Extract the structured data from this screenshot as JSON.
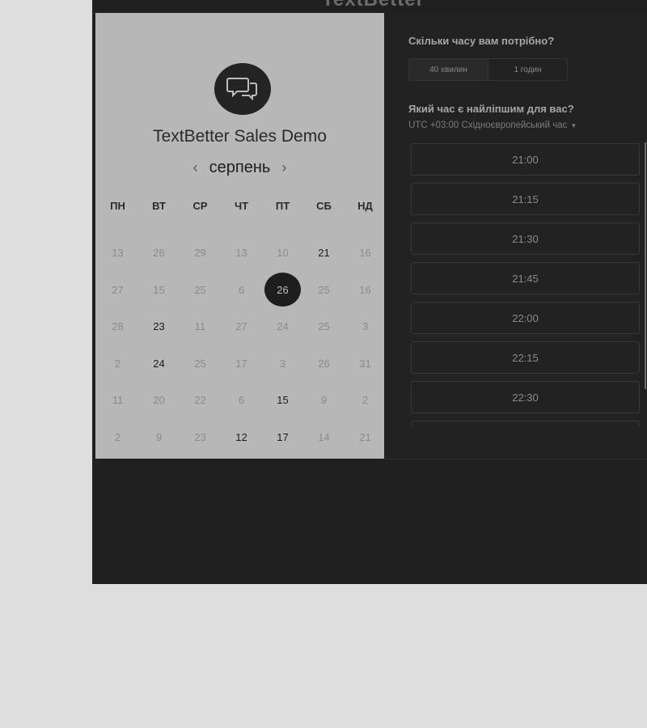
{
  "brand": "TextBetter",
  "event": {
    "title": "TextBetter Sales Demo"
  },
  "calendar": {
    "month": "серпень",
    "prev_arrow": "‹",
    "next_arrow": "›",
    "weekdays": [
      "ПН",
      "ВТ",
      "СР",
      "ЧТ",
      "ПТ",
      "СБ",
      "НД"
    ],
    "selected_day": "26",
    "weeks": [
      [
        [
          "13",
          false
        ],
        [
          "26",
          false
        ],
        [
          "29",
          false
        ],
        [
          "13",
          false
        ],
        [
          "10",
          false
        ],
        [
          "21",
          true
        ],
        [
          "16",
          false
        ]
      ],
      [
        [
          "27",
          false
        ],
        [
          "15",
          false
        ],
        [
          "25",
          false
        ],
        [
          "6",
          false
        ],
        [
          "26",
          "selected"
        ],
        [
          "25",
          false
        ],
        [
          "16",
          false
        ]
      ],
      [
        [
          "28",
          false
        ],
        [
          "23",
          true
        ],
        [
          "11",
          false
        ],
        [
          "27",
          false
        ],
        [
          "24",
          false
        ],
        [
          "25",
          false
        ],
        [
          "3",
          false
        ]
      ],
      [
        [
          "2",
          false
        ],
        [
          "24",
          true
        ],
        [
          "25",
          false
        ],
        [
          "17",
          false
        ],
        [
          "3",
          false
        ],
        [
          "26",
          false
        ],
        [
          "31",
          false
        ]
      ],
      [
        [
          "11",
          false
        ],
        [
          "20",
          false
        ],
        [
          "22",
          false
        ],
        [
          "6",
          false
        ],
        [
          "15",
          true
        ],
        [
          "9",
          false
        ],
        [
          "2",
          false
        ]
      ],
      [
        [
          "2",
          false
        ],
        [
          "9",
          false
        ],
        [
          "23",
          false
        ],
        [
          "12",
          true
        ],
        [
          "17",
          true
        ],
        [
          "14",
          false
        ],
        [
          "21",
          false
        ]
      ]
    ]
  },
  "duration": {
    "question": "Скільки часу вам потрібно?",
    "options": [
      "40 хвилин",
      "1 годин"
    ],
    "selected": "40 хвилин"
  },
  "time": {
    "question": "Який час є найліпшим для вас?",
    "timezone": "UTC +03:00 Східноєвропейський час",
    "slots": [
      "21:00",
      "21:15",
      "21:30",
      "21:45",
      "22:00",
      "22:15",
      "22:30",
      ""
    ]
  }
}
